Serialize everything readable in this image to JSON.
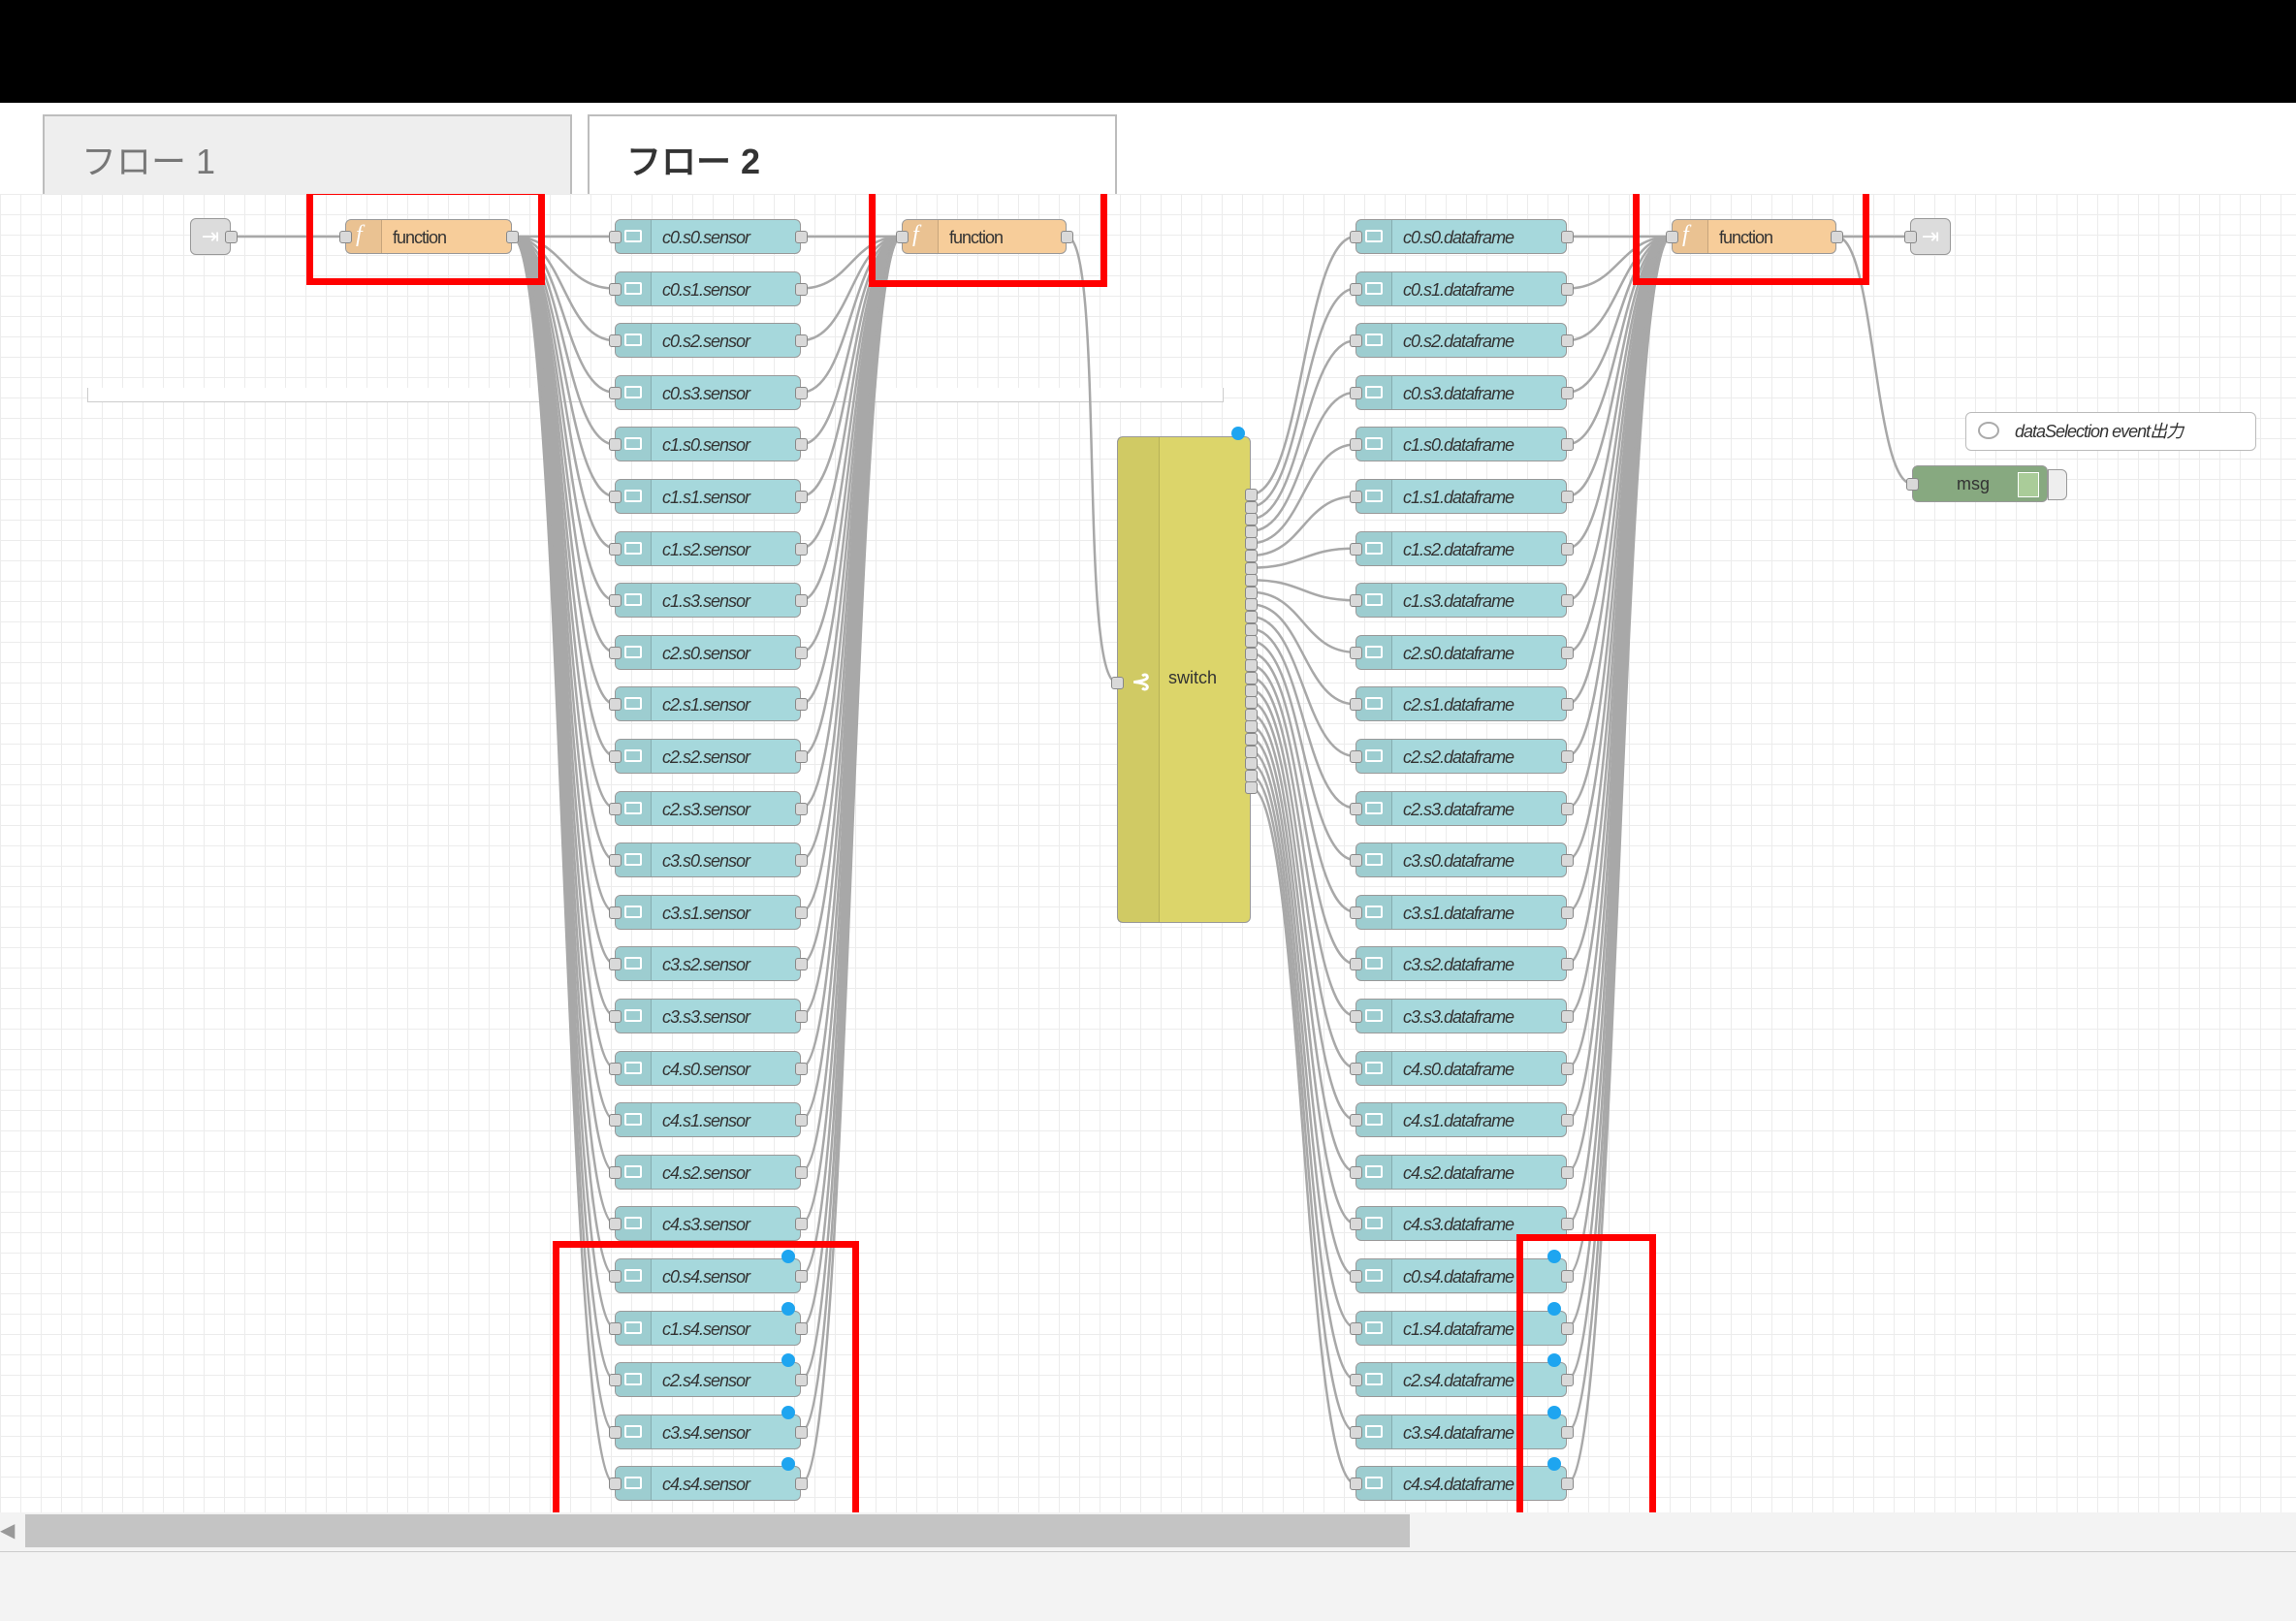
{
  "tabs": [
    "フロー 1",
    "フロー 2"
  ],
  "function_label": "function",
  "switch_label": "switch",
  "comment_label": "dataSelection event出力",
  "debug_label": "msg",
  "sensor_nodes": [
    "c0.s0.sensor",
    "c0.s1.sensor",
    "c0.s2.sensor",
    "c0.s3.sensor",
    "c1.s0.sensor",
    "c1.s1.sensor",
    "c1.s2.sensor",
    "c1.s3.sensor",
    "c2.s0.sensor",
    "c2.s1.sensor",
    "c2.s2.sensor",
    "c2.s3.sensor",
    "c3.s0.sensor",
    "c3.s1.sensor",
    "c3.s2.sensor",
    "c3.s3.sensor",
    "c4.s0.sensor",
    "c4.s1.sensor",
    "c4.s2.sensor",
    "c4.s3.sensor",
    "c0.s4.sensor",
    "c1.s4.sensor",
    "c2.s4.sensor",
    "c3.s4.sensor",
    "c4.s4.sensor"
  ],
  "dataframe_nodes": [
    "c0.s0.dataframe",
    "c0.s1.dataframe",
    "c0.s2.dataframe",
    "c0.s3.dataframe",
    "c1.s0.dataframe",
    "c1.s1.dataframe",
    "c1.s2.dataframe",
    "c1.s3.dataframe",
    "c2.s0.dataframe",
    "c2.s1.dataframe",
    "c2.s2.dataframe",
    "c2.s3.dataframe",
    "c3.s0.dataframe",
    "c3.s1.dataframe",
    "c3.s2.dataframe",
    "c3.s3.dataframe",
    "c4.s0.dataframe",
    "c4.s1.dataframe",
    "c4.s2.dataframe",
    "c4.s3.dataframe",
    "c0.s4.dataframe",
    "c1.s4.dataframe",
    "c2.s4.dataframe",
    "c3.s4.dataframe",
    "c4.s4.dataframe"
  ],
  "modified_count": 5,
  "colors": {
    "link": "#a6d8dc",
    "function": "#f7cd9a",
    "switch": "#dcd56a",
    "debug": "#87a980",
    "highlight": "#ff0000",
    "changed_dot": "#1ea5f0"
  }
}
